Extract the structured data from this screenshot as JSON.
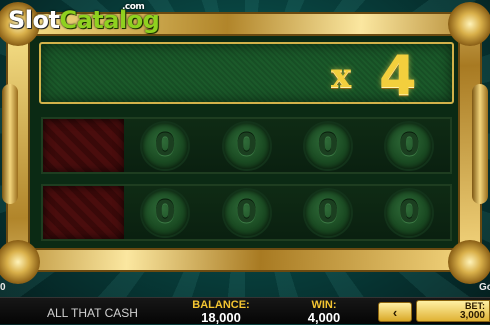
{
  "logo": {
    "slot": "Slot",
    "catalog": "Catalog",
    "com": ".com"
  },
  "multiplier": {
    "x": "x",
    "value": "4"
  },
  "reels": {
    "row1": [
      "",
      "0",
      "0",
      "0",
      "0"
    ],
    "row2": [
      "",
      "0",
      "0",
      "0",
      "0"
    ]
  },
  "edges": {
    "left": "0",
    "right": "Go"
  },
  "bottom_bar": {
    "game_name": "ALL THAT CASH",
    "balance_label": "BALANCE:",
    "balance_value": "18,000",
    "win_label": "WIN:",
    "win_value": "4,000",
    "arrow_icon": "‹",
    "bet_label": "BET:",
    "bet_value": "3,000"
  },
  "colors": {
    "frame_gold": "#c9a23b",
    "accent_yellow": "#f4c531",
    "logo_green": "#8fd11f"
  }
}
